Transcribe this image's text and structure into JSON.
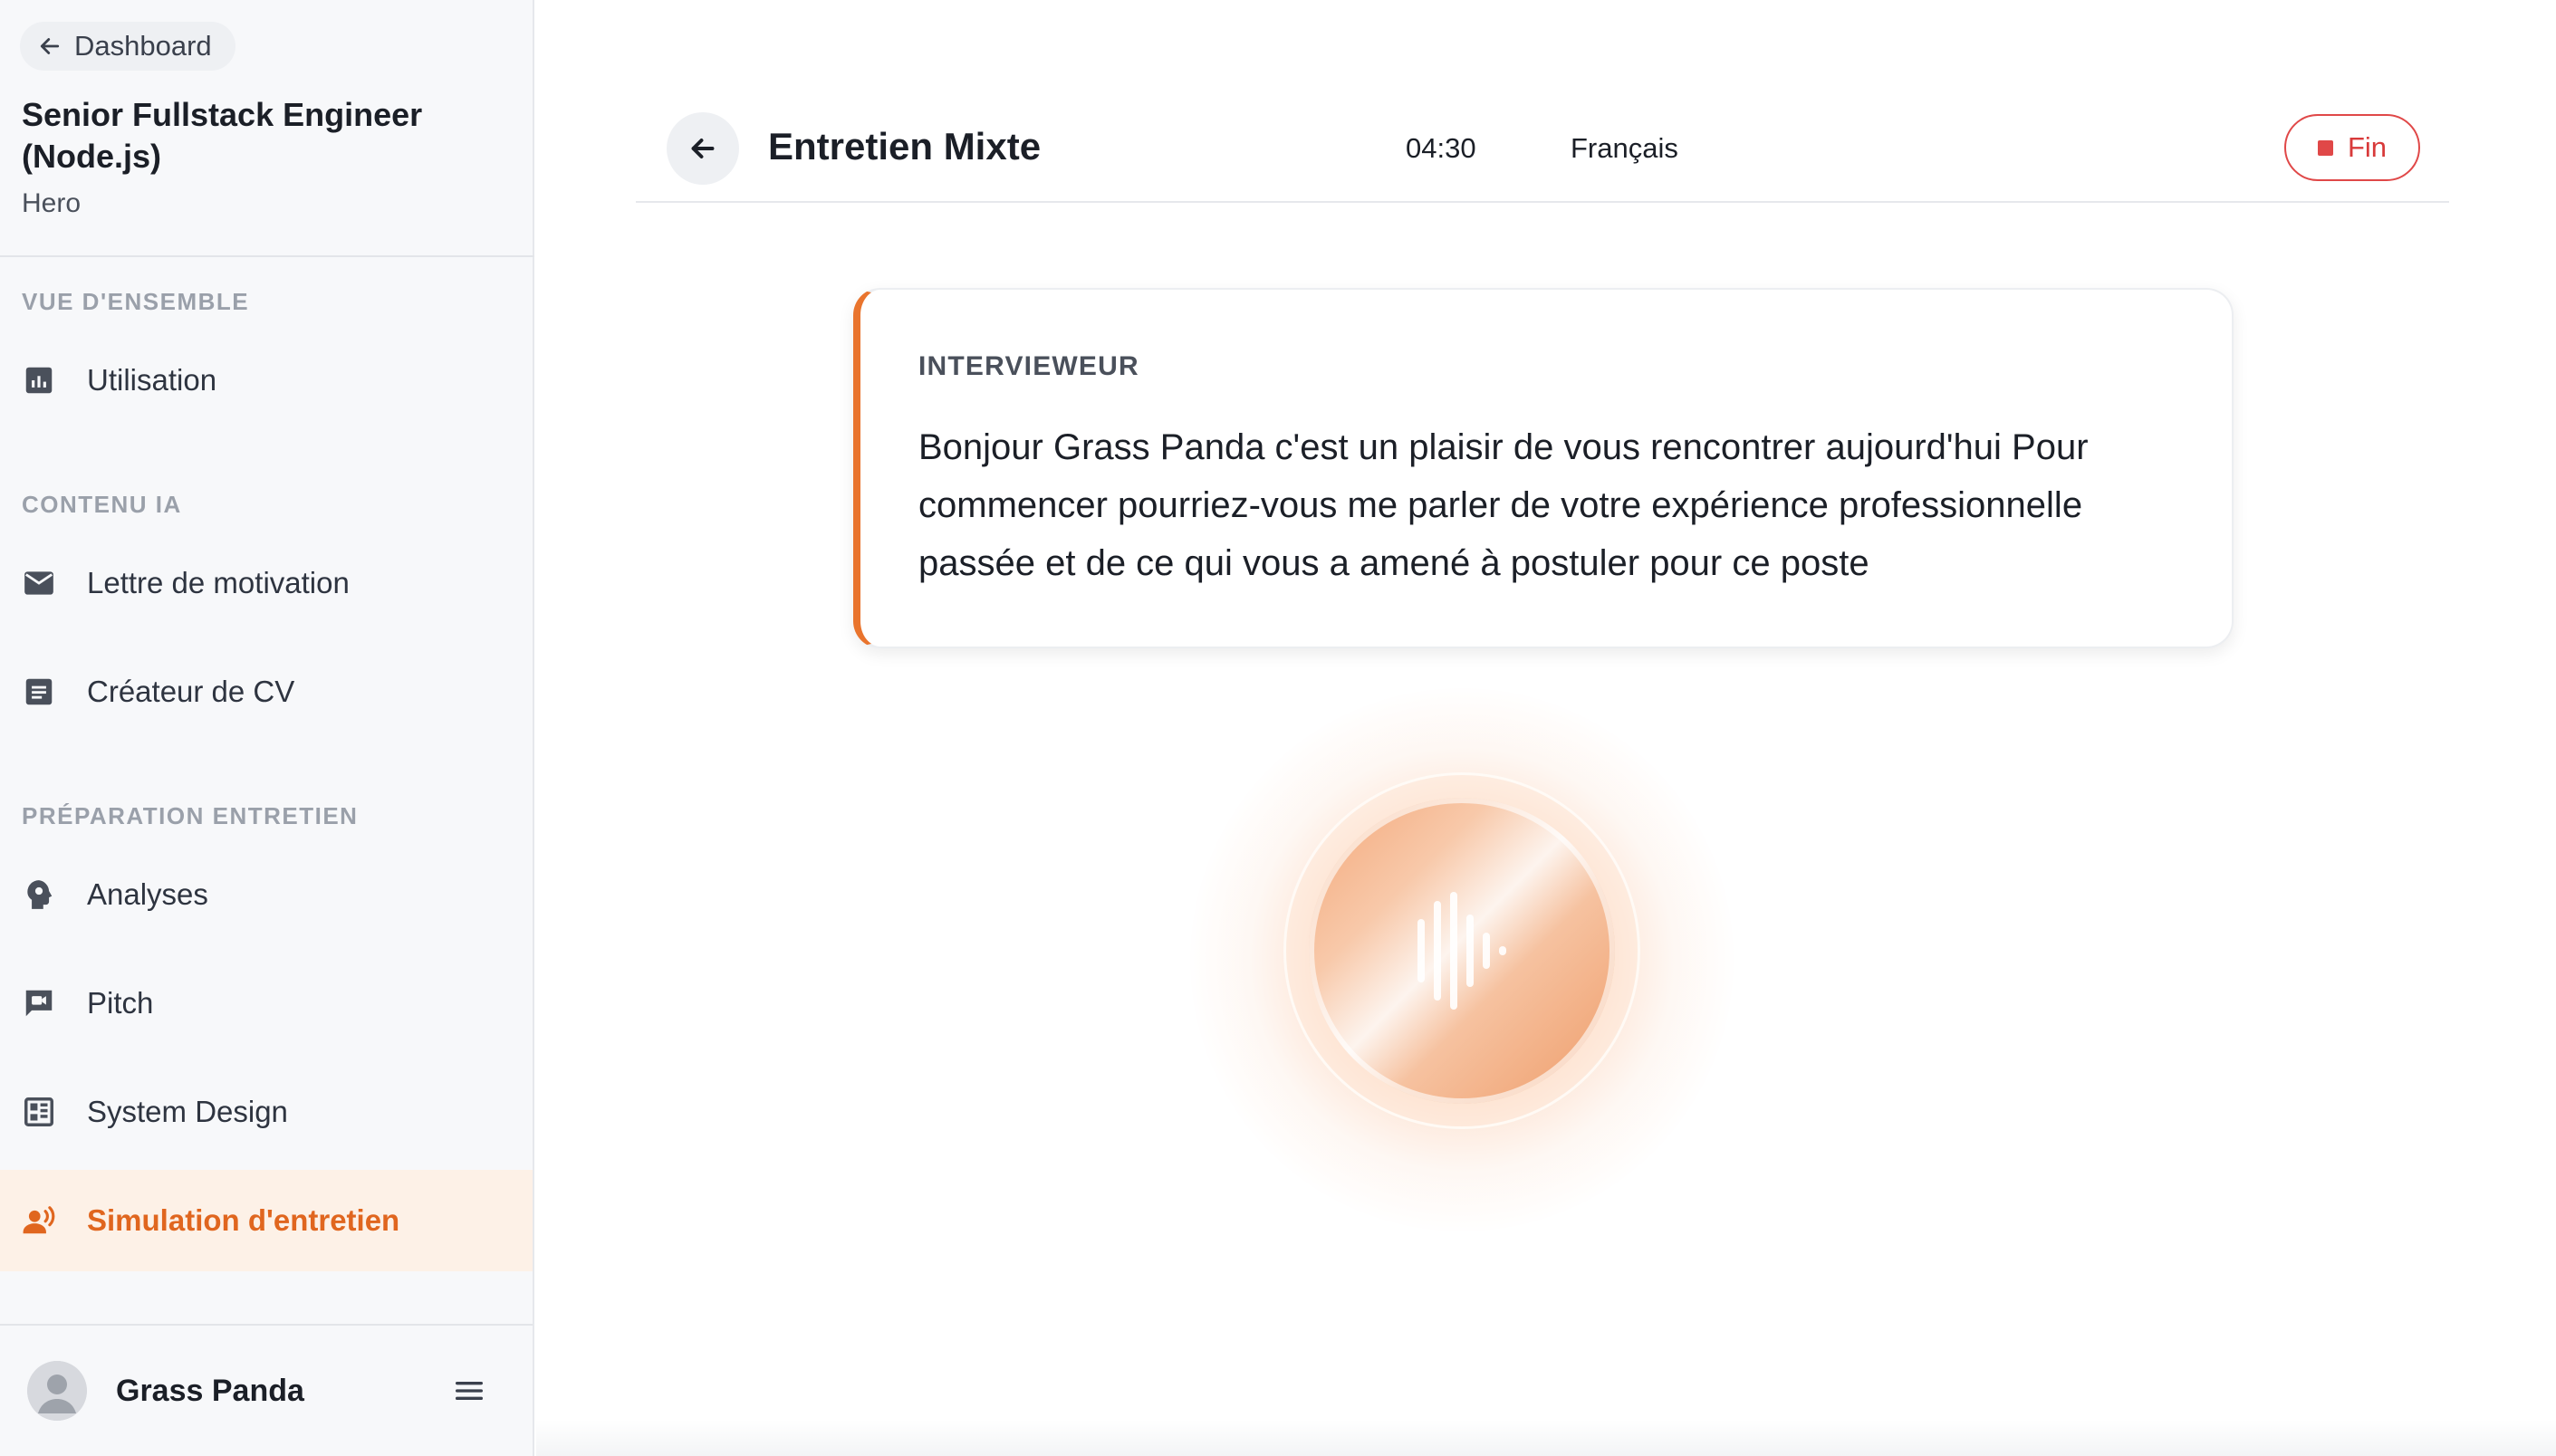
{
  "sidebar": {
    "back_label": "Dashboard",
    "job_title": "Senior Fullstack Engineer (Node.js)",
    "job_subtitle": "Hero",
    "sections": {
      "overview": "VUE D'ENSEMBLE",
      "ai_content": "CONTENU IA",
      "interview_prep": "PRÉPARATION ENTRETIEN"
    },
    "items": {
      "usage": "Utilisation",
      "cover_letter": "Lettre de motivation",
      "cv_builder": "Créateur de CV",
      "analyses": "Analyses",
      "pitch": "Pitch",
      "system_design": "System Design",
      "interview_sim": "Simulation d'entretien"
    },
    "user_name": "Grass Panda"
  },
  "header": {
    "title": "Entretien Mixte",
    "timer": "04:30",
    "language": "Français",
    "end_label": "Fin"
  },
  "message": {
    "role": "INTERVIEWEUR",
    "text": "Bonjour Grass Panda c'est un plaisir de vous rencontrer aujourd'hui Pour commencer pourriez-vous me parler de votre expérience professionnelle passée et de ce qui vous a amené à postuler pour ce poste"
  },
  "colors": {
    "accent": "#e9742d",
    "active_bg": "#fdf1e7",
    "danger": "#e04848"
  }
}
